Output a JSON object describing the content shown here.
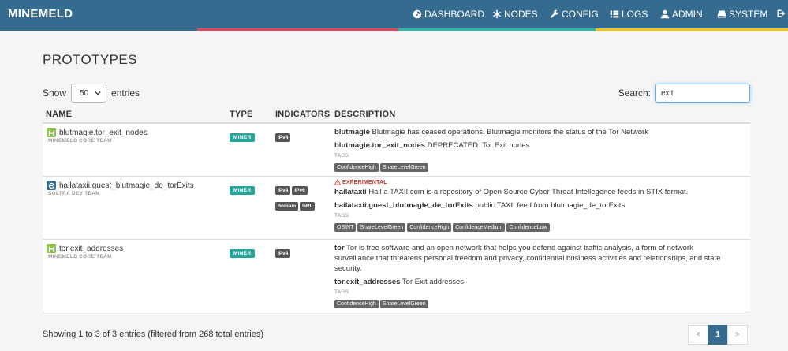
{
  "navbar": {
    "brand": "MINEMELD",
    "items": [
      {
        "label": "DASHBOARD",
        "icon": "dashboard-icon"
      },
      {
        "label": "NODES",
        "icon": "asterisk-icon"
      },
      {
        "label": "CONFIG",
        "icon": "wrench-icon"
      },
      {
        "label": "LOGS",
        "icon": "list-icon"
      },
      {
        "label": "ADMIN",
        "icon": "user-icon"
      },
      {
        "label": "SYSTEM",
        "icon": "hdd-icon"
      }
    ],
    "logout_icon": "logout-icon",
    "stripe_colors": [
      "#356b8e",
      "#e0475b",
      "#2db9a8",
      "#f0c419"
    ]
  },
  "page": {
    "title": "PROTOTYPES",
    "show_label": "Show",
    "entries_value": "50",
    "entries_label": "entries",
    "search_label": "Search:",
    "search_value": "exit"
  },
  "table": {
    "columns": {
      "name": "NAME",
      "type": "TYPE",
      "indicators": "INDICATORS",
      "description": "DESCRIPTION"
    },
    "tags_label": "TAGS",
    "rows": [
      {
        "name": "blutmagie.tor_exit_nodes",
        "team": "MINEMELD CORE TEAM",
        "icon": "minemeld-icon",
        "icon_color": "#8bc34a",
        "type": "MINER",
        "indicators": [
          "IPv4"
        ],
        "experimental": "",
        "desc1_bold": "blutmagie",
        "desc1_text": "Blutmagie has ceased operations. Blutmagie monitors the status of the Tor Network",
        "desc2_bold": "blutmagie.tor_exit_nodes",
        "desc2_text": "DEPRECATED. Tor Exit nodes",
        "tags": [
          "ConfidenceHigh",
          "ShareLevelGreen"
        ]
      },
      {
        "name": "hailataxii.guest_blutmagie_de_torExits",
        "team": "SOLTRA DEV TEAM",
        "icon": "soltra-icon",
        "icon_color": "#3a6f8f",
        "type": "MINER",
        "indicators": [
          "IPv4",
          "IPv6",
          "domain",
          "URL"
        ],
        "experimental": "EXPERIMENTAL",
        "desc1_bold": "hailataxii",
        "desc1_text": "Hail a TAXII.com is a repository of Open Source Cyber Threat Intellegence feeds in STIX format.",
        "desc2_bold": "hailataxii.guest_blutmagie_de_torExits",
        "desc2_text": "public TAXII feed from blutmagie_de_torExits",
        "tags": [
          "OSINT",
          "ShareLevelGreen",
          "ConfidenceHigh",
          "ConfidenceMedium",
          "ConfidenceLow"
        ]
      },
      {
        "name": "tor.exit_addresses",
        "team": "MINEMELD CORE TEAM",
        "icon": "minemeld-icon",
        "icon_color": "#8bc34a",
        "type": "MINER",
        "indicators": [
          "IPv4"
        ],
        "experimental": "",
        "desc1_bold": "tor",
        "desc1_text": "Tor is free software and an open network that helps you defend against traffic analysis, a form of network surveillance that threatens personal freedom and privacy, confidential business activities and relationships, and state security.",
        "desc2_bold": "tor.exit_addresses",
        "desc2_text": "Tor Exit addresses",
        "tags": [
          "ConfidenceHigh",
          "ShareLevelGreen"
        ]
      }
    ]
  },
  "footer": {
    "info": "Showing 1 to 3 of 3 entries (filtered from 268 total entries)",
    "prev": "<",
    "current": "1",
    "next": ">"
  }
}
